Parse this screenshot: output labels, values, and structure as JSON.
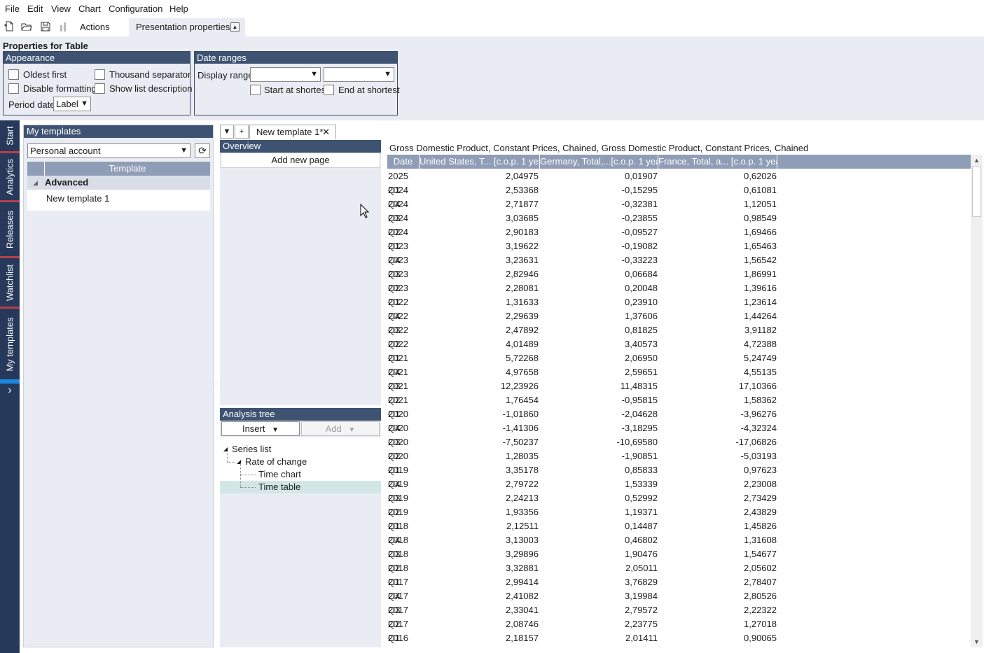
{
  "menu": [
    "File",
    "Edit",
    "View",
    "Chart",
    "Configuration",
    "Help"
  ],
  "toolbar": {
    "actions_label": "Actions",
    "presentation_tab": "Presentation properties"
  },
  "properties": {
    "title": "Properties for Table",
    "appearance": {
      "header": "Appearance",
      "oldest_first": "Oldest first",
      "thousand_separator": "Thousand separator",
      "disable_formatting": "Disable formatting",
      "show_list_description": "Show list description",
      "period_date_label": "Period date",
      "period_date_value": "Label"
    },
    "date_ranges": {
      "header": "Date ranges",
      "display_range_label": "Display range",
      "start_at_shortest": "Start at shortest",
      "end_at_shortest": "End at shortest"
    }
  },
  "side_tabs": [
    "Start",
    "Analytics",
    "Releases",
    "Watchlist",
    "My templates"
  ],
  "side_expand": "›",
  "my_templates": {
    "header": "My templates",
    "account": "Personal account",
    "column_header": "Template",
    "group": "Advanced",
    "items": [
      "New template 1"
    ]
  },
  "doc_tab": {
    "label": "New template 1*"
  },
  "overview": {
    "header": "Overview",
    "add_page": "Add new page"
  },
  "analysis_tree": {
    "header": "Analysis tree",
    "insert": "Insert",
    "add": "Add",
    "nodes": [
      "Series list",
      "Rate of change",
      "Time chart",
      "Time table"
    ]
  },
  "table": {
    "title": "Gross Domestic Product, Constant Prices, Chained, Gross Domestic Product, Constant Prices, Chained",
    "columns": [
      "Date",
      "United States, T... [c.o.p. 1 year]",
      "Germany, Total,...[c.o.p. 1 year]",
      "France, Total, a... [c.o.p. 1 year]"
    ],
    "rows": [
      [
        "2025 Q1",
        "2,04975",
        "0,01907",
        "0,62026"
      ],
      [
        "2024 Q4",
        "2,53368",
        "-0,15295",
        "0,61081"
      ],
      [
        "2024 Q3",
        "2,71877",
        "-0,32381",
        "1,12051"
      ],
      [
        "2024 Q2",
        "3,03685",
        "-0,23855",
        "0,98549"
      ],
      [
        "2024 Q1",
        "2,90183",
        "-0,09527",
        "1,69466"
      ],
      [
        "2023 Q4",
        "3,19622",
        "-0,19082",
        "1,65463"
      ],
      [
        "2023 Q3",
        "3,23631",
        "-0,33223",
        "1,56542"
      ],
      [
        "2023 Q2",
        "2,82946",
        "0,06684",
        "1,86991"
      ],
      [
        "2023 Q1",
        "2,28081",
        "0,20048",
        "1,39616"
      ],
      [
        "2022 Q4",
        "1,31633",
        "0,23910",
        "1,23614"
      ],
      [
        "2022 Q3",
        "2,29639",
        "1,37606",
        "1,44264"
      ],
      [
        "2022 Q2",
        "2,47892",
        "0,81825",
        "3,91182"
      ],
      [
        "2022 Q1",
        "4,01489",
        "3,40573",
        "4,72388"
      ],
      [
        "2021 Q4",
        "5,72268",
        "2,06950",
        "5,24749"
      ],
      [
        "2021 Q3",
        "4,97658",
        "2,59651",
        "4,55135"
      ],
      [
        "2021 Q2",
        "12,23926",
        "11,48315",
        "17,10366"
      ],
      [
        "2021 Q1",
        "1,76454",
        "-0,95815",
        "1,58362"
      ],
      [
        "2020 Q4",
        "-1,01860",
        "-2,04628",
        "-3,96276"
      ],
      [
        "2020 Q3",
        "-1,41306",
        "-3,18295",
        "-4,32324"
      ],
      [
        "2020 Q2",
        "-7,50237",
        "-10,69580",
        "-17,06826"
      ],
      [
        "2020 Q1",
        "1,28035",
        "-1,90851",
        "-5,03193"
      ],
      [
        "2019 Q4",
        "3,35178",
        "0,85833",
        "0,97623"
      ],
      [
        "2019 Q3",
        "2,79722",
        "1,53339",
        "2,23008"
      ],
      [
        "2019 Q2",
        "2,24213",
        "0,52992",
        "2,73429"
      ],
      [
        "2019 Q1",
        "1,93356",
        "1,19371",
        "2,43829"
      ],
      [
        "2018 Q4",
        "2,12511",
        "0,14487",
        "1,45826"
      ],
      [
        "2018 Q3",
        "3,13003",
        "0,46802",
        "1,31608"
      ],
      [
        "2018 Q2",
        "3,29896",
        "1,90476",
        "1,54677"
      ],
      [
        "2018 Q1",
        "3,32881",
        "2,05011",
        "2,05602"
      ],
      [
        "2017 Q4",
        "2,99414",
        "3,76829",
        "2,78407"
      ],
      [
        "2017 Q3",
        "2,41082",
        "3,19984",
        "2,80526"
      ],
      [
        "2017 Q2",
        "2,33041",
        "2,79572",
        "2,22322"
      ],
      [
        "2017 Q1",
        "2,08746",
        "2,23775",
        "1,27018"
      ],
      [
        "2016 Q4",
        "2,18157",
        "2,01411",
        "0,90065"
      ]
    ]
  }
}
